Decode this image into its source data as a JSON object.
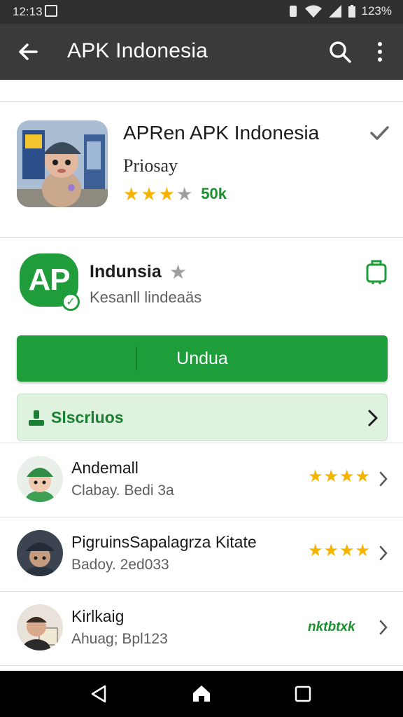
{
  "status_bar": {
    "time": "12:13",
    "battery": "123%",
    "icons": [
      "gallery-icon",
      "vibrate-icon",
      "wifi-icon",
      "signal-icon",
      "battery-icon"
    ]
  },
  "app_bar": {
    "title": "APK Indonesia",
    "icons": [
      "back-arrow-icon",
      "search-icon",
      "more-vert-icon"
    ]
  },
  "app": {
    "name": "APRen APK Indonesia",
    "publisher": "Priosay",
    "rating": 3,
    "rating_max": 5,
    "review_count": "50k",
    "installed_icon": "check-icon"
  },
  "developer": {
    "logo_text": "AP",
    "name": "Indunsia",
    "subtitle": "Kesanll lindeaäs",
    "wishlist_icon": "bookmark-icon"
  },
  "install_button": {
    "label": "Undua"
  },
  "subscribe": {
    "label": "Slscrluos",
    "icon": "person-icon"
  },
  "list": [
    {
      "title": "Andemall",
      "meta": "Clabay. Bedi 3a",
      "rating": 4.5,
      "avatar": "green-hat-character"
    },
    {
      "title": "PigruinsSapalagrza Kitate",
      "meta": "Badoy. 2ed033",
      "rating": 3.5,
      "avatar": "hat-character"
    },
    {
      "title": "Kirlkaig",
      "meta": "Ahuag; Bpl123",
      "tag": "nktbtxk",
      "avatar": "person-photo"
    }
  ],
  "colors": {
    "app_bar": "#3a3a3a",
    "status_bar": "#2f2f2f",
    "accent_green": "#1e9d3b",
    "star": "#f4b400",
    "subscribe_bg": "#dff1df"
  }
}
